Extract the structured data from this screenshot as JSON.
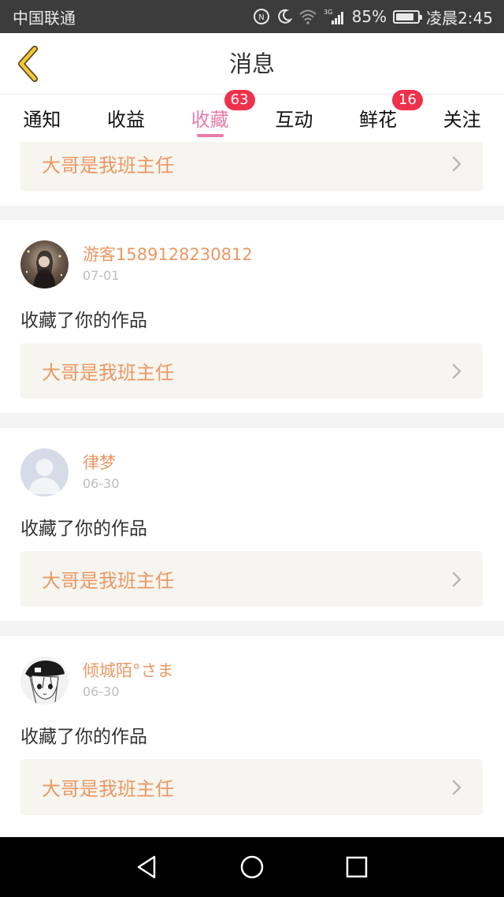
{
  "status_bar": {
    "carrier": "中国联通",
    "battery_percent": "85%",
    "battery_level": 0.85,
    "time": "凌晨2:45",
    "network": "3G"
  },
  "nav": {
    "title": "消息",
    "back_icon": "chevron-left-icon"
  },
  "tabs": [
    {
      "label": "通知",
      "badge": null,
      "active": false
    },
    {
      "label": "收益",
      "badge": null,
      "active": false
    },
    {
      "label": "收藏",
      "badge": "63",
      "active": true
    },
    {
      "label": "互动",
      "badge": null,
      "active": false
    },
    {
      "label": "鲜花",
      "badge": "16",
      "active": false
    },
    {
      "label": "关注",
      "badge": null,
      "active": false
    }
  ],
  "items": [
    {
      "username": "",
      "date": "",
      "message": "",
      "work_title": "大哥是我班主任"
    },
    {
      "username": "游客1589128230812",
      "date": "07-01",
      "message": "收藏了你的作品",
      "work_title": "大哥是我班主任"
    },
    {
      "username": "律梦",
      "date": "06-30",
      "message": "收藏了你的作品",
      "work_title": "大哥是我班主任"
    },
    {
      "username": "倾城陌°さま",
      "date": "06-30",
      "message": "收藏了你的作品",
      "work_title": "大哥是我班主任"
    }
  ],
  "colors": {
    "accent_pink": "#e77cab",
    "badge_red": "#f0314b",
    "orange_text": "#eb9863",
    "back_arrow": "#f3c93a"
  }
}
